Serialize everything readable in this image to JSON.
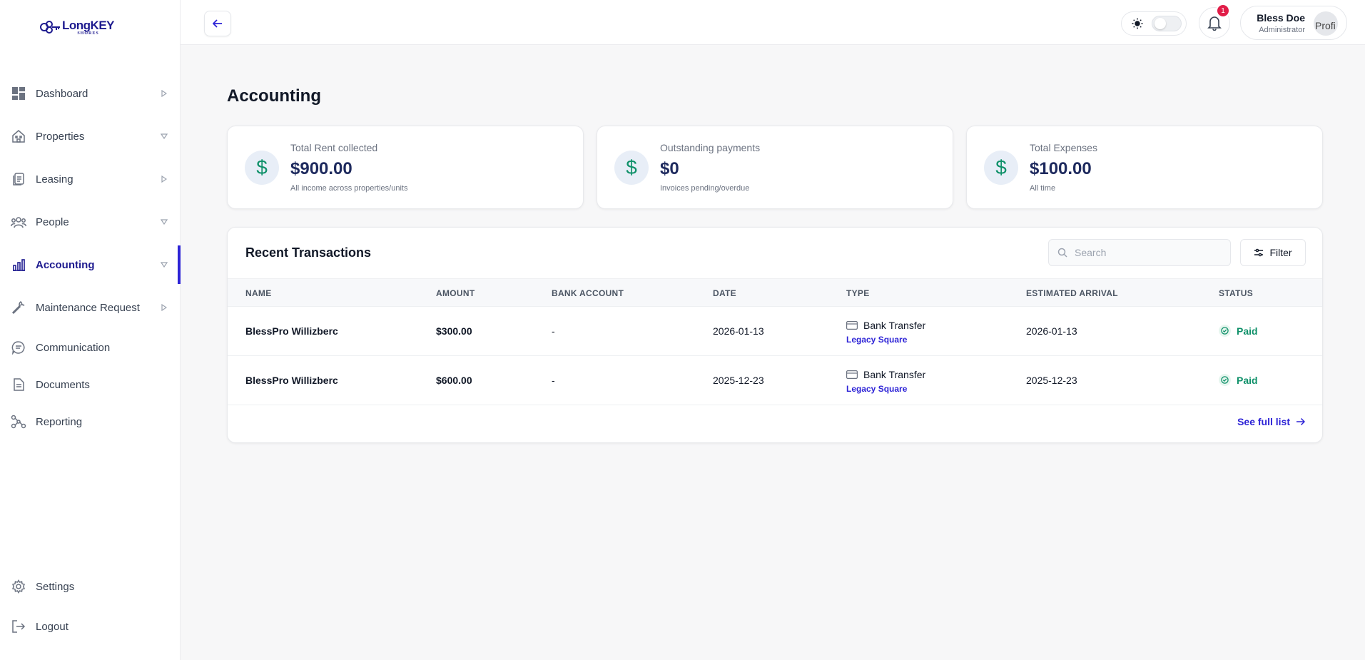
{
  "logo": {
    "main": "LongKEY",
    "sub": "SHORES"
  },
  "sidebar": {
    "items": [
      {
        "label": "Dashboard",
        "icon": "dashboard-icon",
        "caret": "right"
      },
      {
        "label": "Properties",
        "icon": "building-icon",
        "caret": "down"
      },
      {
        "label": "Leasing",
        "icon": "documents-stack-icon",
        "caret": "right"
      },
      {
        "label": "People",
        "icon": "people-icon",
        "caret": "down"
      },
      {
        "label": "Accounting",
        "icon": "bar-chart-icon",
        "caret": "down",
        "active": true
      },
      {
        "label": "Maintenance Request",
        "icon": "wrench-icon",
        "caret": "right"
      },
      {
        "label": "Communication",
        "icon": "chat-icon",
        "caret": "none"
      },
      {
        "label": "Documents",
        "icon": "document-icon",
        "caret": "none"
      },
      {
        "label": "Reporting",
        "icon": "nodes-icon",
        "caret": "none"
      }
    ],
    "bottom": [
      {
        "label": "Settings",
        "icon": "gear-icon"
      },
      {
        "label": "Logout",
        "icon": "logout-icon"
      }
    ]
  },
  "topbar": {
    "notification_count": "1",
    "user_name": "Bless Doe",
    "user_role": "Administrator",
    "avatar_alt": "Profi"
  },
  "page": {
    "title": "Accounting"
  },
  "stats": [
    {
      "label": "Total Rent collected",
      "value": "$900.00",
      "sub": "All income across properties/units"
    },
    {
      "label": "Outstanding payments",
      "value": "$0",
      "sub": "Invoices pending/overdue"
    },
    {
      "label": "Total Expenses",
      "value": "$100.00",
      "sub": "All time"
    }
  ],
  "transactions": {
    "title": "Recent Transactions",
    "search_placeholder": "Search",
    "filter_label": "Filter",
    "columns": [
      "NAME",
      "AMOUNT",
      "BANK ACCOUNT",
      "DATE",
      "TYPE",
      "ESTIMATED ARRIVAL",
      "STATUS"
    ],
    "rows": [
      {
        "name": "BlessPro Willizberc",
        "amount": "$300.00",
        "bank_account": "-",
        "date": "2026-01-13",
        "type": "Bank Transfer",
        "property": "Legacy Square",
        "arrival": "2026-01-13",
        "status": "Paid"
      },
      {
        "name": "BlessPro Willizberc",
        "amount": "$600.00",
        "bank_account": "-",
        "date": "2025-12-23",
        "type": "Bank Transfer",
        "property": "Legacy Square",
        "arrival": "2025-12-23",
        "status": "Paid"
      }
    ],
    "see_full_list": "See full list"
  },
  "colors": {
    "accent": "#2d23d6",
    "brand": "#1e1b8f",
    "success": "#10916a",
    "badge": "#e11d48"
  }
}
